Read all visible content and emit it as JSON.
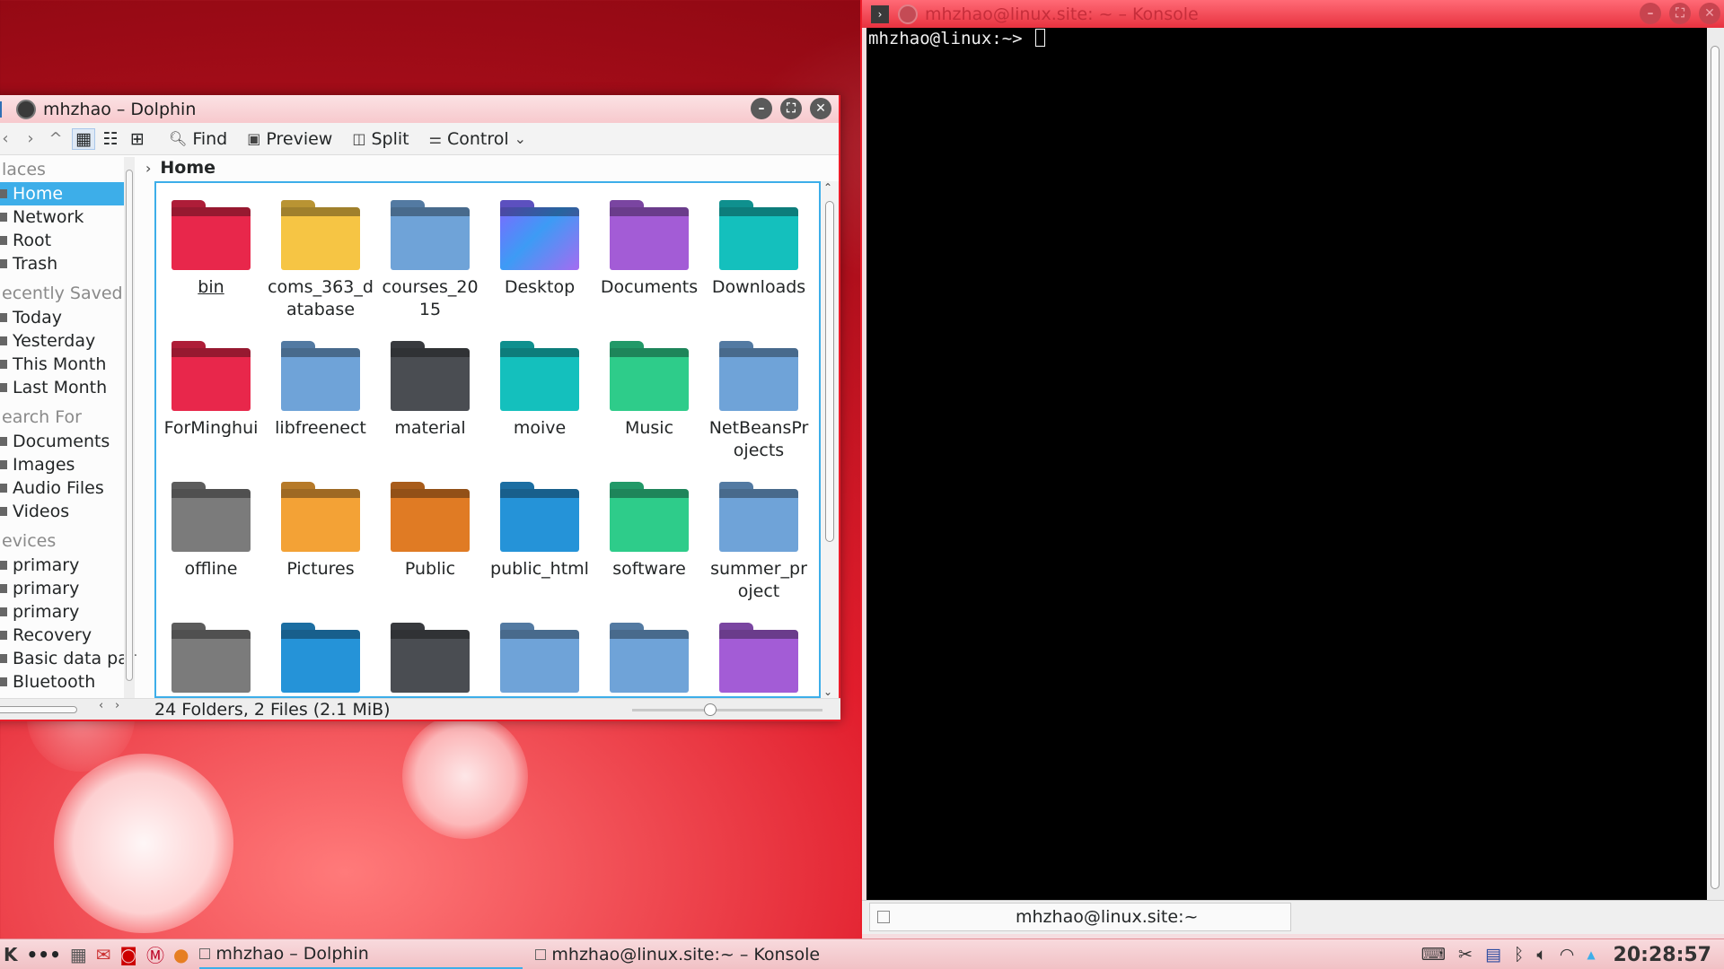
{
  "colors": {
    "accent": "#3daee9",
    "window_border": "#ec1d2a",
    "clock": "#d31d2a"
  },
  "dolphin": {
    "title": "mhzhao – Dolphin",
    "toolbar": {
      "back_icon": "chevron-left-icon",
      "forward_icon": "chevron-right-icon",
      "up_icon": "chevron-up-icon",
      "find": "Find",
      "preview": "Preview",
      "split": "Split",
      "control": "Control"
    },
    "sidebar": {
      "groups": [
        {
          "label": "laces",
          "items": [
            {
              "label": "Home",
              "selected": true
            },
            {
              "label": "Network"
            },
            {
              "label": "Root"
            },
            {
              "label": "Trash"
            }
          ]
        },
        {
          "label": "ecently Saved",
          "items": [
            {
              "label": "Today"
            },
            {
              "label": "Yesterday"
            },
            {
              "label": "This Month"
            },
            {
              "label": "Last Month"
            }
          ]
        },
        {
          "label": "earch For",
          "items": [
            {
              "label": "Documents"
            },
            {
              "label": "Images"
            },
            {
              "label": "Audio Files"
            },
            {
              "label": "Videos"
            }
          ]
        },
        {
          "label": "evices",
          "items": [
            {
              "label": "primary"
            },
            {
              "label": "primary"
            },
            {
              "label": "primary"
            },
            {
              "label": "Recovery"
            },
            {
              "label": "Basic data part"
            },
            {
              "label": "Bluetooth"
            }
          ]
        }
      ]
    },
    "breadcrumb": "Home",
    "files": [
      {
        "name": "bin",
        "color": "#e8274b",
        "underline": true
      },
      {
        "name": "coms_363_database",
        "color": "#f6c544"
      },
      {
        "name": "courses_2015",
        "color": "#6fa3d8"
      },
      {
        "name": "Desktop",
        "color": "#7a6bff",
        "image": true
      },
      {
        "name": "Documents",
        "color": "#a35cd6"
      },
      {
        "name": "Downloads",
        "color": "#14c0bd"
      },
      {
        "name": "ForMinghui",
        "color": "#e8274b"
      },
      {
        "name": "libfreenect",
        "color": "#6fa3d8"
      },
      {
        "name": "material",
        "color": "#4a4d52"
      },
      {
        "name": "moive",
        "color": "#14c0bd"
      },
      {
        "name": "Music",
        "color": "#2ecc8a"
      },
      {
        "name": "NetBeansProjects",
        "color": "#6fa3d8"
      },
      {
        "name": "offline",
        "color": "#7b7b7b"
      },
      {
        "name": "Pictures",
        "color": "#f3a236"
      },
      {
        "name": "Public",
        "color": "#e07b24"
      },
      {
        "name": "public_html",
        "color": "#2593d8"
      },
      {
        "name": "software",
        "color": "#2ecc8a"
      },
      {
        "name": "summer_project",
        "color": "#6fa3d8"
      },
      {
        "name": "",
        "color": "#7b7b7b"
      },
      {
        "name": "",
        "color": "#2593d8"
      },
      {
        "name": "",
        "color": "#4a4d52"
      },
      {
        "name": "",
        "color": "#6fa3d8"
      },
      {
        "name": "",
        "color": "#6fa3d8"
      },
      {
        "name": "",
        "color": "#a35cd6"
      }
    ],
    "status": "24 Folders, 2 Files (2.1 MiB)"
  },
  "konsole": {
    "title": "mhzhao@linux.site: ~ – Konsole",
    "prompt": "mhzhao@linux:~> ",
    "tab_label": "mhzhao@linux.site:~"
  },
  "taskbar": {
    "tasks": [
      {
        "label": "mhzhao – Dolphin"
      },
      {
        "label": "mhzhao@linux.site:~ – Konsole"
      }
    ],
    "clock": "20:28:57"
  }
}
